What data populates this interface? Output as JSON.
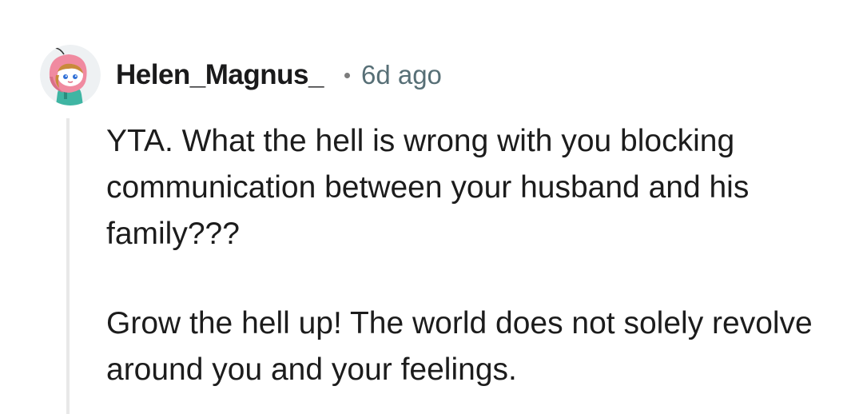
{
  "comment": {
    "avatar_icon": "snoo-avatar-pink-hood-icon",
    "username": "Helen_Magnus_",
    "separator": "•",
    "timestamp": "6d ago",
    "paragraphs": [
      "YTA. What the hell is wrong with you blocking communication between your husband and his family???",
      "Grow the hell up! The world does not solely revolve around you and your feelings."
    ]
  },
  "colors": {
    "username": "#1a1a1b",
    "timestamp": "#576f76",
    "text": "#1c1c1c",
    "thread_line": "#e8e8e8",
    "avatar_hood": "#f08aa0",
    "avatar_body": "#3fb5a3"
  }
}
